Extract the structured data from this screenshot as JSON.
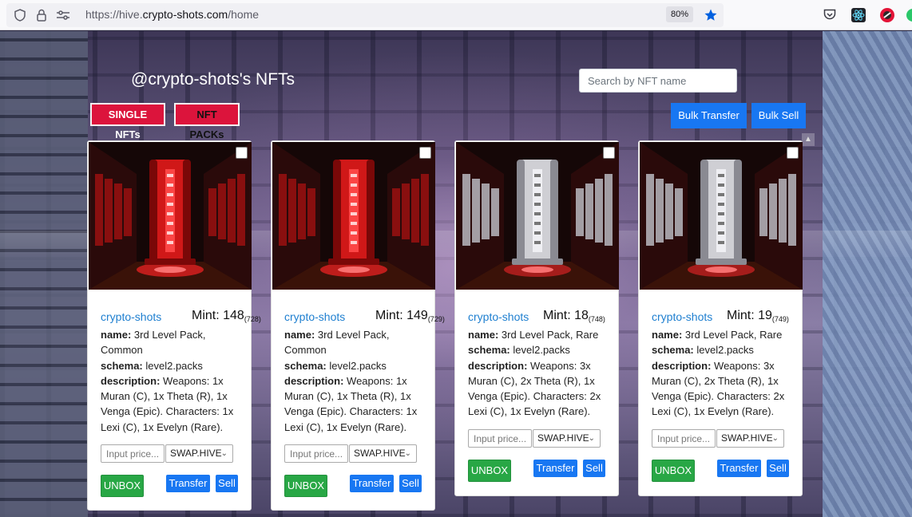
{
  "browser": {
    "url_scheme": "https://hive.",
    "url_host": "crypto-shots.com",
    "url_path": "/home",
    "zoom": "80%"
  },
  "page": {
    "title": "@crypto-shots's NFTs",
    "search_placeholder": "Search by NFT name",
    "tab_single": "SINGLE NFTs",
    "tab_packs": "NFT PACKs",
    "bulk_transfer": "Bulk Transfer",
    "bulk_sell": "Bulk Sell"
  },
  "labels": {
    "name": "name:",
    "schema": "schema:",
    "description": "description:",
    "price_placeholder": "Input price...",
    "unbox": "UNBOX",
    "transfer": "Transfer",
    "sell": "Sell"
  },
  "cards": [
    {
      "creator": "crypto-shots",
      "mint_label": "Mint: 148",
      "mint_total": "(728)",
      "name": "3rd Level Pack, Common",
      "schema": "level2.packs",
      "description": "Weapons: 1x Muran (C), 1x Theta (R), 1x Venga (Epic). Characters: 1x Lexi (C), 1x Evelyn (Rare).",
      "token": "SWAP.HIVE",
      "variant": "red"
    },
    {
      "creator": "crypto-shots",
      "mint_label": "Mint: 149",
      "mint_total": "(729)",
      "name": "3rd Level Pack, Common",
      "schema": "level2.packs",
      "description": "Weapons: 1x Muran (C), 1x Theta (R), 1x Venga (Epic). Characters: 1x Lexi (C), 1x Evelyn (Rare).",
      "token": "SWAP.HIVE",
      "variant": "red"
    },
    {
      "creator": "crypto-shots",
      "mint_label": "Mint: 18",
      "mint_total": "(748)",
      "name": "3rd Level Pack, Rare",
      "schema": "level2.packs",
      "description": "Weapons: 3x Muran (C), 2x Theta (R), 1x Venga (Epic). Characters: 2x Lexi (C), 1x Evelyn (Rare).",
      "token": "SWAP.HIVE",
      "variant": "silver"
    },
    {
      "creator": "crypto-shots",
      "mint_label": "Mint: 19",
      "mint_total": "(749)",
      "name": "3rd Level Pack, Rare",
      "schema": "level2.packs",
      "description": "Weapons: 3x Muran (C), 2x Theta (R), 1x Venga (Epic). Characters: 2x Lexi (C), 1x Evelyn (Rare).",
      "token": "SWAP.HIVE",
      "variant": "silver"
    }
  ]
}
